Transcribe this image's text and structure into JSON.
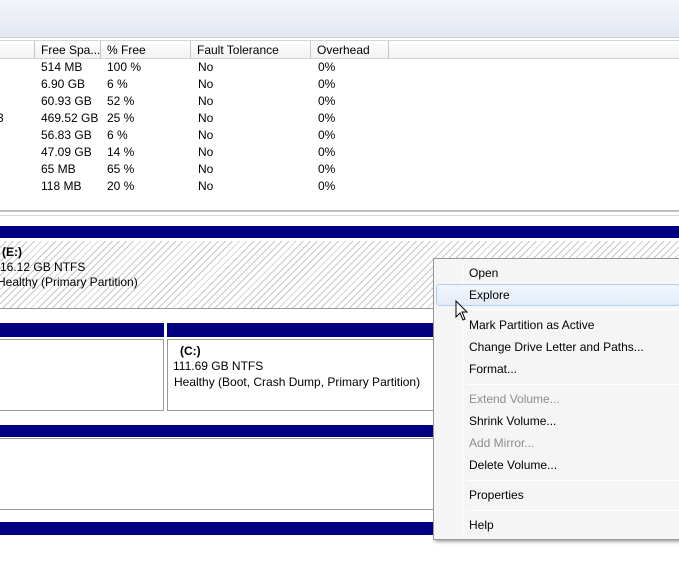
{
  "columns": [
    "Free Spa...",
    "% Free",
    "Fault Tolerance",
    "Overhead"
  ],
  "volume_rows": [
    {
      "prefix": "",
      "free_space": "514 MB",
      "percent_free": "100 %",
      "fault_tolerance": "No",
      "overhead": "0%"
    },
    {
      "prefix": "",
      "free_space": "6.90 GB",
      "percent_free": "6 %",
      "fault_tolerance": "No",
      "overhead": "0%"
    },
    {
      "prefix": "",
      "free_space": "60.93 GB",
      "percent_free": "52 %",
      "fault_tolerance": "No",
      "overhead": "0%"
    },
    {
      "prefix": "3",
      "free_space": "469.52 GB",
      "percent_free": "25 %",
      "fault_tolerance": "No",
      "overhead": "0%"
    },
    {
      "prefix": "",
      "free_space": "56.83 GB",
      "percent_free": "6 %",
      "fault_tolerance": "No",
      "overhead": "0%"
    },
    {
      "prefix": "",
      "free_space": "47.09 GB",
      "percent_free": "14 %",
      "fault_tolerance": "No",
      "overhead": "0%"
    },
    {
      "prefix": "",
      "free_space": "65 MB",
      "percent_free": "65 %",
      "fault_tolerance": "No",
      "overhead": "0%"
    },
    {
      "prefix": "",
      "free_space": "118 MB",
      "percent_free": "20 %",
      "fault_tolerance": "No",
      "overhead": "0%"
    }
  ],
  "volume_e": {
    "name": "(E:)",
    "size": "16.12 GB NTFS",
    "status": "Healthy (Primary Partition)"
  },
  "volume_c": {
    "name": "(C:)",
    "size": "111.69 GB NTFS",
    "status": "Healthy (Boot, Crash Dump, Primary Partition)"
  },
  "context_menu": {
    "open": "Open",
    "explore": "Explore",
    "mark_active": "Mark Partition as Active",
    "change_letter": "Change Drive Letter and Paths...",
    "format": "Format...",
    "extend": "Extend Volume...",
    "shrink": "Shrink Volume...",
    "add_mirror": "Add Mirror...",
    "delete": "Delete Volume...",
    "properties": "Properties",
    "help": "Help"
  },
  "colors": {
    "partition_bar": "#000080",
    "menu_hover": "#e3ecf8",
    "disabled_text": "#8d8d8d"
  }
}
